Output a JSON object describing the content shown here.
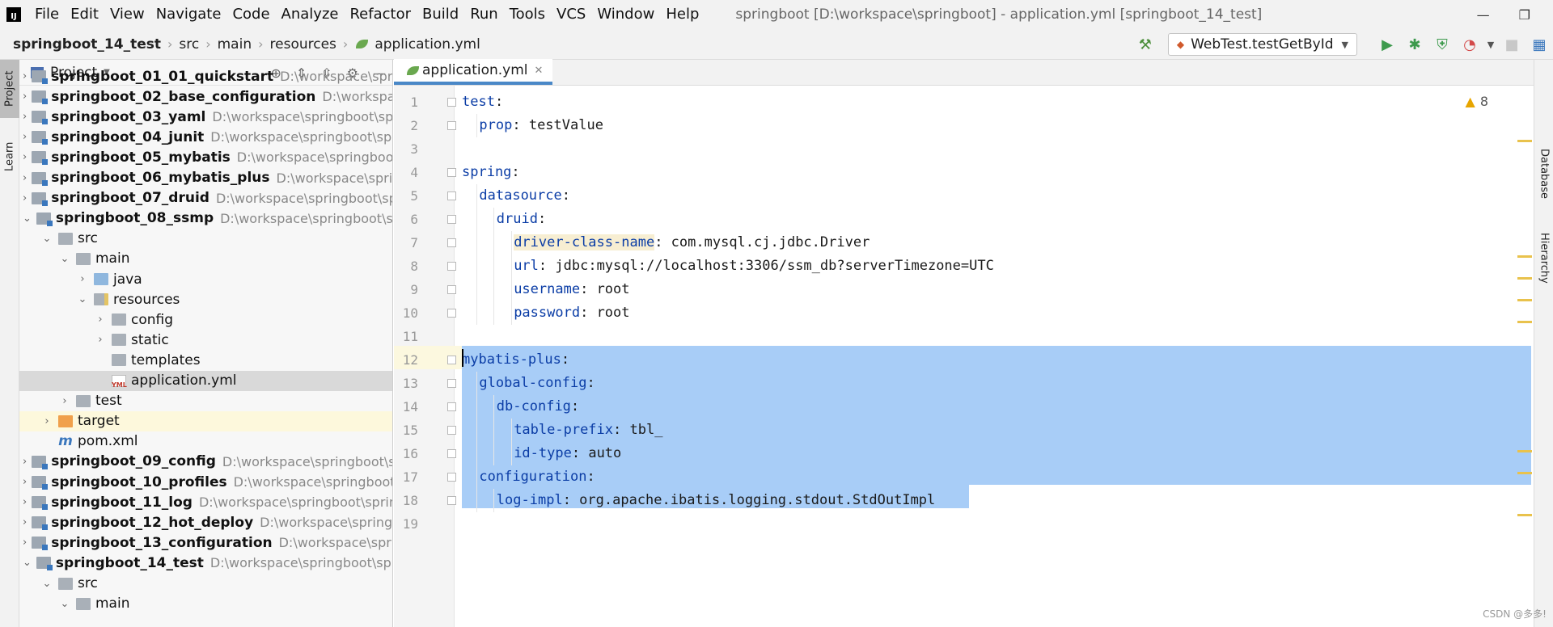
{
  "menubar": {
    "items": [
      "File",
      "Edit",
      "View",
      "Navigate",
      "Code",
      "Analyze",
      "Refactor",
      "Build",
      "Run",
      "Tools",
      "VCS",
      "Window",
      "Help"
    ],
    "window_title": "springboot [D:\\workspace\\springboot] - application.yml [springboot_14_test]"
  },
  "breadcrumb": [
    "springboot_14_test",
    "src",
    "main",
    "resources",
    "application.yml"
  ],
  "toolbar": {
    "run_config": "WebTest.testGetById"
  },
  "left_strip": {
    "tabs": [
      "Project",
      "Learn"
    ]
  },
  "right_strip": {
    "tabs": [
      "Database",
      "Hierarchy"
    ]
  },
  "project_panel": {
    "title": "Project",
    "tree": [
      {
        "name": "springboot_01_01_quickstart",
        "path": "D:\\workspace\\springboot\\spri",
        "depth": 0,
        "type": "module",
        "expanded": false
      },
      {
        "name": "springboot_02_base_configuration",
        "path": "D:\\workspace\\s",
        "depth": 0,
        "type": "module",
        "expanded": false
      },
      {
        "name": "springboot_03_yaml",
        "path": "D:\\workspace\\springboot\\sprin",
        "depth": 0,
        "type": "module",
        "expanded": false
      },
      {
        "name": "springboot_04_junit",
        "path": "D:\\workspace\\springboot\\sprin",
        "depth": 0,
        "type": "module",
        "expanded": false
      },
      {
        "name": "springboot_05_mybatis",
        "path": "D:\\workspace\\springboot\\s",
        "depth": 0,
        "type": "module",
        "expanded": false
      },
      {
        "name": "springboot_06_mybatis_plus",
        "path": "D:\\workspace\\springb",
        "depth": 0,
        "type": "module",
        "expanded": false
      },
      {
        "name": "springboot_07_druid",
        "path": "D:\\workspace\\springboot\\spri",
        "depth": 0,
        "type": "module",
        "expanded": false
      },
      {
        "name": "springboot_08_ssmp",
        "path": "D:\\workspace\\springboot\\spri",
        "depth": 0,
        "type": "module",
        "expanded": true
      },
      {
        "name": "src",
        "path": "",
        "depth": 1,
        "type": "folder",
        "expanded": true
      },
      {
        "name": "main",
        "path": "",
        "depth": 2,
        "type": "folder",
        "expanded": true
      },
      {
        "name": "java",
        "path": "",
        "depth": 3,
        "type": "src",
        "expanded": false
      },
      {
        "name": "resources",
        "path": "",
        "depth": 3,
        "type": "res",
        "expanded": true
      },
      {
        "name": "config",
        "path": "",
        "depth": 4,
        "type": "folder",
        "expanded": false
      },
      {
        "name": "static",
        "path": "",
        "depth": 4,
        "type": "folder",
        "expanded": false
      },
      {
        "name": "templates",
        "path": "",
        "depth": 4,
        "type": "folder",
        "leaf": true
      },
      {
        "name": "application.yml",
        "path": "",
        "depth": 4,
        "type": "yml",
        "leaf": true,
        "selected": true
      },
      {
        "name": "test",
        "path": "",
        "depth": 2,
        "type": "folder",
        "expanded": false
      },
      {
        "name": "target",
        "path": "",
        "depth": 1,
        "type": "target",
        "expanded": false,
        "target": true
      },
      {
        "name": "pom.xml",
        "path": "",
        "depth": 1,
        "type": "pom",
        "leaf": true
      },
      {
        "name": "springboot_09_config",
        "path": "D:\\workspace\\springboot\\spr",
        "depth": 0,
        "type": "module",
        "expanded": false
      },
      {
        "name": "springboot_10_profiles",
        "path": "D:\\workspace\\springboot\\s",
        "depth": 0,
        "type": "module",
        "expanded": false
      },
      {
        "name": "springboot_11_log",
        "path": "D:\\workspace\\springboot\\spring",
        "depth": 0,
        "type": "module",
        "expanded": false
      },
      {
        "name": "springboot_12_hot_deploy",
        "path": "D:\\workspace\\springbo",
        "depth": 0,
        "type": "module",
        "expanded": false
      },
      {
        "name": "springboot_13_configuration",
        "path": "D:\\workspace\\springl",
        "depth": 0,
        "type": "module",
        "expanded": false
      },
      {
        "name": "springboot_14_test",
        "path": "D:\\workspace\\springboot\\spring",
        "depth": 0,
        "type": "module",
        "expanded": true
      },
      {
        "name": "src",
        "path": "",
        "depth": 1,
        "type": "folder",
        "expanded": true
      },
      {
        "name": "main",
        "path": "",
        "depth": 2,
        "type": "folder",
        "expanded": true
      }
    ]
  },
  "editor": {
    "tab_label": "application.yml",
    "warning_count": "8",
    "lines": [
      {
        "n": "1",
        "indent": 0,
        "key": "test",
        "sep": ":",
        "value": ""
      },
      {
        "n": "2",
        "indent": 1,
        "key": "prop",
        "sep": ":",
        "value": " testValue"
      },
      {
        "n": "3",
        "indent": 0,
        "key": "",
        "sep": "",
        "value": ""
      },
      {
        "n": "4",
        "indent": 0,
        "key": "spring",
        "sep": ":",
        "value": ""
      },
      {
        "n": "5",
        "indent": 1,
        "key": "datasource",
        "sep": ":",
        "value": ""
      },
      {
        "n": "6",
        "indent": 2,
        "key": "druid",
        "sep": ":",
        "value": ""
      },
      {
        "n": "7",
        "indent": 3,
        "key": "driver-class-name",
        "sep": ":",
        "value": " com.mysql.cj.jdbc.Driver"
      },
      {
        "n": "8",
        "indent": 3,
        "key": "url",
        "sep": ":",
        "value": " jdbc:mysql://localhost:3306/ssm_db?serverTimezone=UTC"
      },
      {
        "n": "9",
        "indent": 3,
        "key": "username",
        "sep": ":",
        "value": " root"
      },
      {
        "n": "10",
        "indent": 3,
        "key": "password",
        "sep": ":",
        "value": " root"
      },
      {
        "n": "11",
        "indent": 0,
        "key": "",
        "sep": "",
        "value": ""
      },
      {
        "n": "12",
        "indent": 0,
        "key": "mybatis-plus",
        "sep": ":",
        "value": ""
      },
      {
        "n": "13",
        "indent": 1,
        "key": "global-config",
        "sep": ":",
        "value": ""
      },
      {
        "n": "14",
        "indent": 2,
        "key": "db-config",
        "sep": ":",
        "value": ""
      },
      {
        "n": "15",
        "indent": 3,
        "key": "table-prefix",
        "sep": ":",
        "value": " tbl_"
      },
      {
        "n": "16",
        "indent": 3,
        "key": "id-type",
        "sep": ":",
        "value": " auto"
      },
      {
        "n": "17",
        "indent": 1,
        "key": "configuration",
        "sep": ":",
        "value": ""
      },
      {
        "n": "18",
        "indent": 2,
        "key": "log-impl",
        "sep": ":",
        "value": " org.apache.ibatis.logging.stdout.StdOutImpl"
      },
      {
        "n": "19",
        "indent": 0,
        "key": "",
        "sep": "",
        "value": ""
      }
    ]
  },
  "watermark": "CSDN @多多!",
  "colors": {
    "yaml_key": "#0b3da6",
    "selection": "#a8cdf7",
    "tab_underline": "#4a88c7",
    "warning": "#e7a500"
  }
}
